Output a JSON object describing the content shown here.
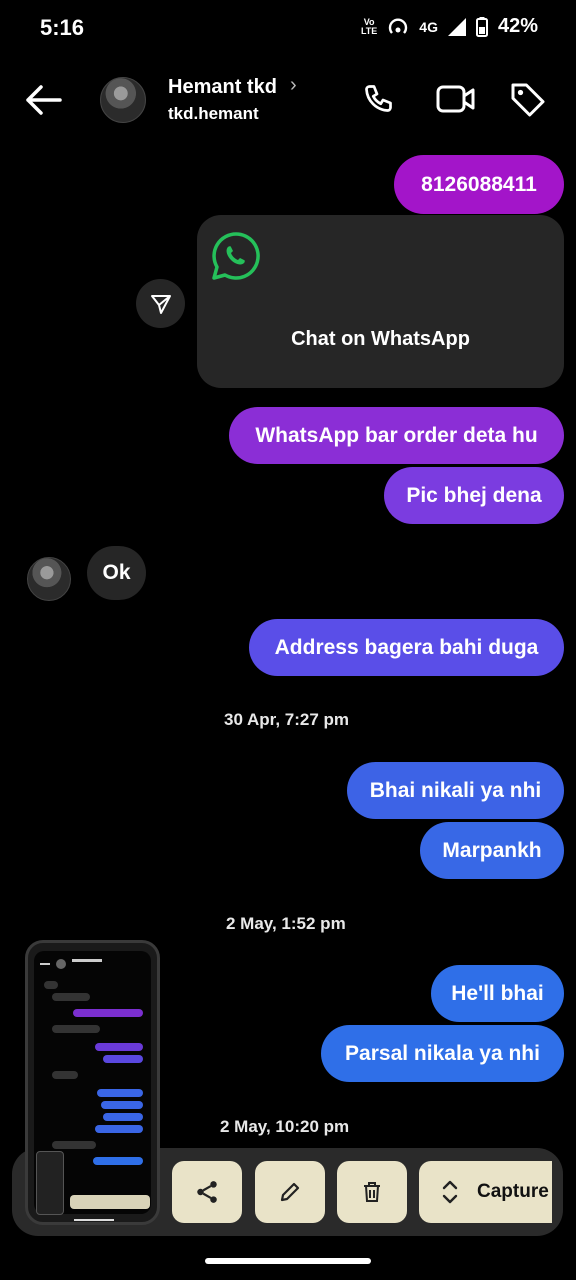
{
  "status_bar": {
    "time": "5:16",
    "volte": "Vo\nLTE",
    "network": "4G",
    "battery": "42%"
  },
  "header": {
    "name": "Hemant tkd",
    "chevron": "›",
    "username": "tkd.hemant"
  },
  "messages": {
    "m1": "8126088411",
    "whatsapp_card": "Chat on WhatsApp",
    "m2": "WhatsApp bar order deta hu",
    "m3": "Pic bhej dena",
    "m4_received": "Ok",
    "m5": "Address bagera bahi duga",
    "date1": "30 Apr, 7:27 pm",
    "m6": "Bhai nikali ya nhi",
    "m7": "Marpankh",
    "date2": "2 May, 1:52 pm",
    "m8": "He'll bhai",
    "m9": "Parsal nikala ya nhi",
    "date3": "2 May, 10:20 pm"
  },
  "toolbar": {
    "capture_label": "Capture"
  },
  "colors": {
    "purple_top": "#a315c9",
    "purple_mid": "#7b3ce0",
    "indigo": "#5a4ee8",
    "blue": "#2f6fe8",
    "toolbar_btn": "#e9e3c8",
    "whatsapp_green": "#25c05a"
  },
  "icons": [
    "back-arrow-icon",
    "phone-icon",
    "video-icon",
    "tag-icon",
    "send-icon",
    "whatsapp-icon",
    "share-icon",
    "edit-icon",
    "delete-icon",
    "expand-icon"
  ]
}
